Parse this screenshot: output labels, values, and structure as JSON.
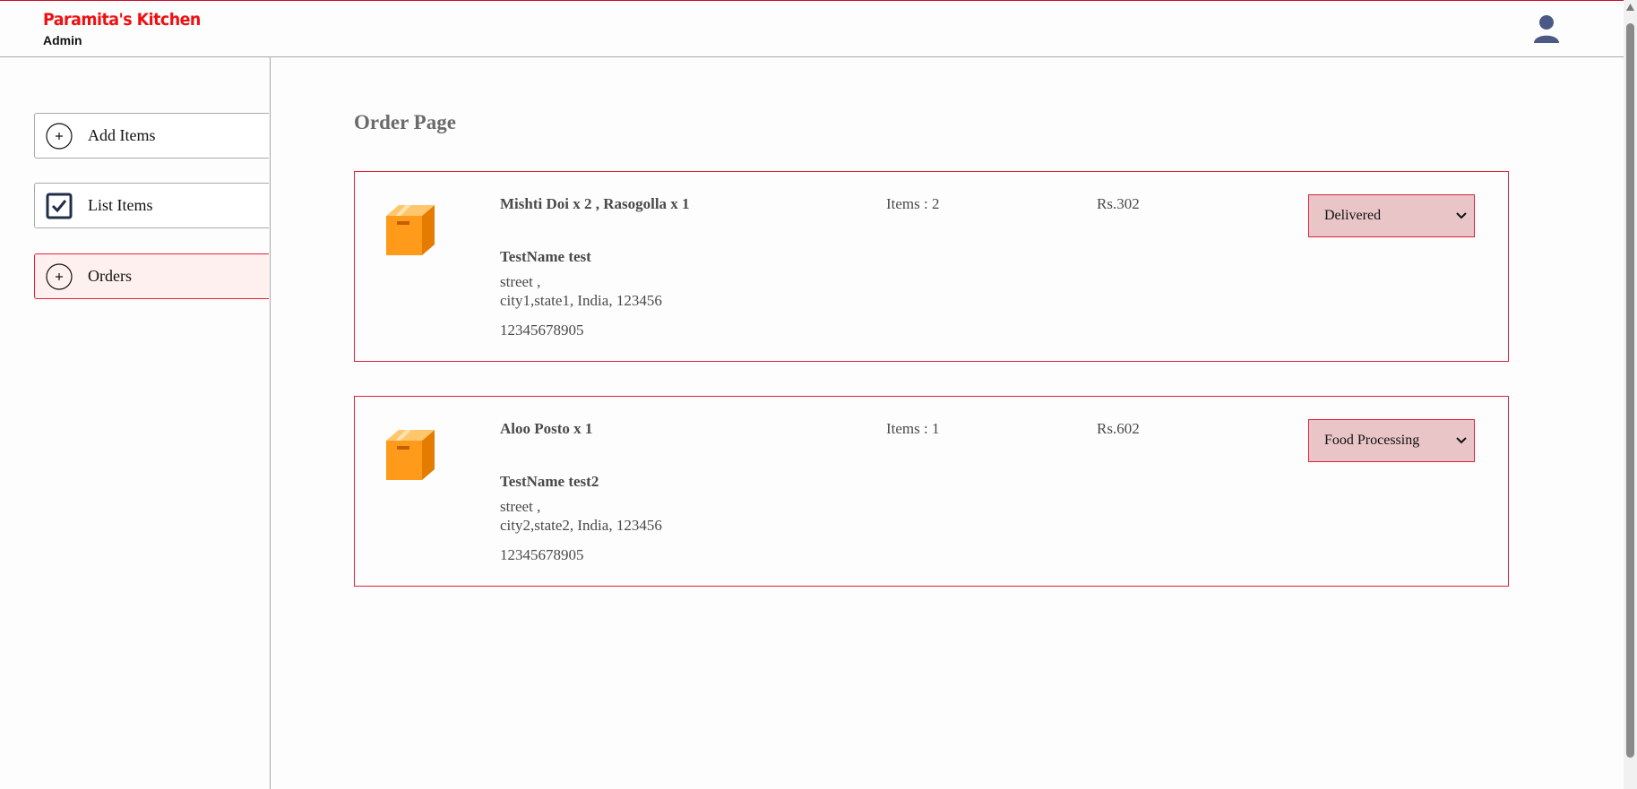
{
  "header": {
    "brand": "Paramita's Kitchen",
    "subtitle": "Admin",
    "profile_icon": "user-icon"
  },
  "sidebar": {
    "items": [
      {
        "label": "Add Items",
        "icon": "plus-circle-icon",
        "active": false
      },
      {
        "label": "List Items",
        "icon": "checkbox-icon",
        "active": false
      },
      {
        "label": "Orders",
        "icon": "plus-circle-icon",
        "active": true
      }
    ]
  },
  "main": {
    "title": "Order Page",
    "orders": [
      {
        "items": "Mishti Doi x 2 , Rasogolla x 1",
        "name": "TestName test",
        "street": "street ,",
        "city_line": "city1,state1, India, 123456",
        "phone": "12345678905",
        "count": "Items : 2",
        "amount": "Rs.302",
        "status": "Delivered"
      },
      {
        "items": "Aloo Posto x 1",
        "name": "TestName test2",
        "street": "street ,",
        "city_line": "city2,state2, India, 123456",
        "phone": "12345678905",
        "count": "Items : 1",
        "amount": "Rs.602",
        "status": "Food Processing"
      }
    ]
  },
  "colors": {
    "brand": "#ee1111",
    "accent_border": "#e0203a",
    "status_bg": "#e9c5c8",
    "active_bg": "#fff0f0",
    "parcel": "#ff9a1a"
  }
}
